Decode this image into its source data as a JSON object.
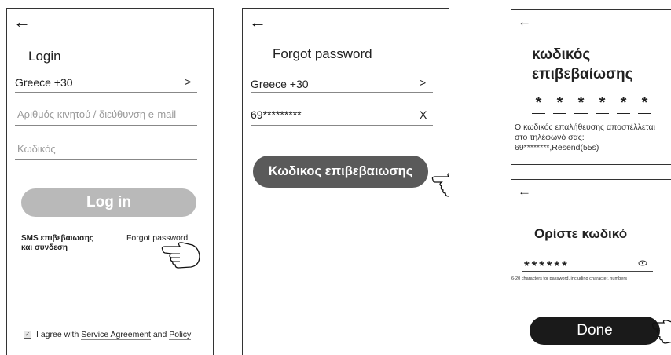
{
  "login": {
    "back_icon": "arrow-left-icon",
    "title": "Login",
    "country": "Greece +30",
    "country_arrow": ">",
    "phone_placeholder": "Αριθμός κινητού / διεύθυνση e-mail",
    "password_placeholder": "Κωδικός",
    "login_button": "Log in",
    "sms_login_line1": "SMS επιβεβαιωσης",
    "sms_login_line2": "και συνδεση",
    "forgot_password": "Forgot password",
    "agree_prefix": "I agree with",
    "service_agreement": "Service Agreement",
    "agree_and": "and",
    "policy": "Policy",
    "checkbox_mark": "✓"
  },
  "forgot": {
    "back_icon": "arrow-left-icon",
    "title": "Forgot password",
    "country": "Greece +30",
    "country_arrow": ">",
    "phone_value": "69*********",
    "clear_label": "X",
    "code_button": "Κωδικος επιβεβαιωσης"
  },
  "verify": {
    "back_icon": "arrow-left-icon",
    "title_line1": "κωδικός",
    "title_line2": "επιβεβαίωσης",
    "digits": [
      "*",
      "*",
      "*",
      "*",
      "*",
      "*"
    ],
    "message_line1": "Ο κωδικός επαλήθευσης αποστέλλεται",
    "message_line2": "στο τηλέφωνό σας:",
    "message_line3": "69********,Resend(55s)"
  },
  "set_password": {
    "back_icon": "arrow-left-icon",
    "title": "Ορίστε κωδικό",
    "password_value": "******",
    "eye_icon": "eye-icon",
    "hint": "6-20 characters for password, including character, numbers",
    "done_button": "Done"
  },
  "icons": {
    "pointer": "pointing-hand-icon"
  },
  "colors": {
    "login_button": "#b9b9b9",
    "code_button": "#5a5a5a",
    "done_button": "#1a1a1a"
  }
}
